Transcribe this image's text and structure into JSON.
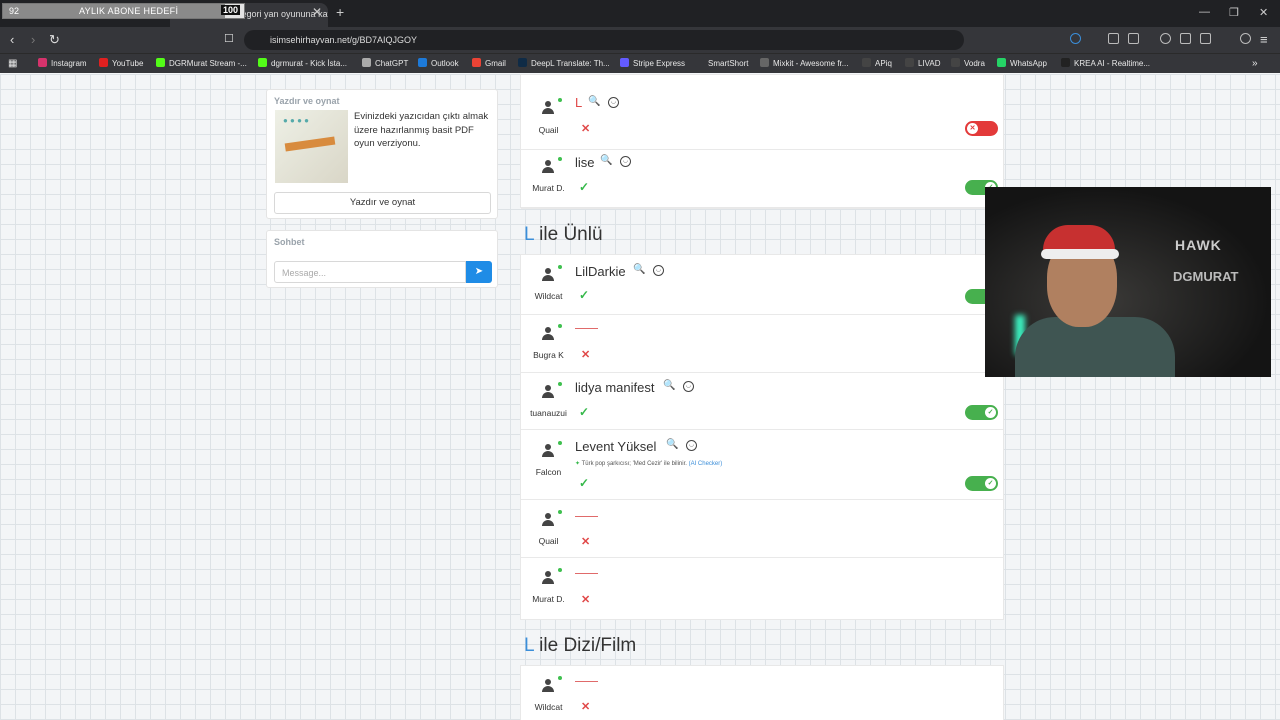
{
  "overlay": {
    "current": "92",
    "label": "AYLIK ABONE HEDEFİ",
    "goal": "100",
    "progress": 0.92
  },
  "browser": {
    "tab_title": "Kategori yan oyununa katıl",
    "url": "isimsehirhayvan.net/g/BD7AIQJGOY",
    "bookmarks": [
      {
        "label": "Instagram",
        "color": "#d6336c"
      },
      {
        "label": "YouTube",
        "color": "#e02020"
      },
      {
        "label": "DGRMurat Stream -...",
        "color": "#53fc18"
      },
      {
        "label": "dgrmurat - Kick İsta...",
        "color": "#53fc18"
      },
      {
        "label": "ChatGPT",
        "color": "#aaaaaa"
      },
      {
        "label": "Outlook",
        "color": "#1d7ad9"
      },
      {
        "label": "Gmail",
        "color": "#ea4335"
      },
      {
        "label": "DeepL Translate: Th...",
        "color": "#0f2b46"
      },
      {
        "label": "Stripe Express",
        "color": "#635bff"
      },
      {
        "label": "SmartShort",
        "color": "#35363a"
      },
      {
        "label": "Mixkit - Awesome fr...",
        "color": "#666666"
      },
      {
        "label": "APiq",
        "color": "#444444"
      },
      {
        "label": "LIVAD",
        "color": "#444444"
      },
      {
        "label": "Vodra",
        "color": "#444444"
      },
      {
        "label": "WhatsApp",
        "color": "#25d366"
      },
      {
        "label": "KREA AI - Realtime...",
        "color": "#222222"
      }
    ]
  },
  "sidebar": {
    "print": {
      "title": "Yazdır ve oynat",
      "description": "Evinizdeki yazıcıdan çıktı almak üzere hazırlanmış basit PDF oyun verziyonu.",
      "button": "Yazdır ve oynat"
    },
    "chat": {
      "title": "Sohbet",
      "placeholder": "Message..."
    }
  },
  "top_block": {
    "rows": [
      {
        "user": "Quail",
        "answer": "L",
        "valid": false
      },
      {
        "user": "Murat D.",
        "answer": "lise",
        "valid": true
      }
    ]
  },
  "sections": [
    {
      "letter": "L",
      "title": "ile Ünlü",
      "rows": [
        {
          "user": "Wildcat",
          "answer": "LilDarkie",
          "valid": true
        },
        {
          "user": "Bugra K",
          "answer": "",
          "valid": false
        },
        {
          "user": "tuanauzui",
          "answer": "lidya manifest",
          "valid": true
        },
        {
          "user": "Falcon",
          "answer": "Levent Yüksel",
          "valid": true,
          "note": "Türk pop şarkıcısı; 'Med Cezir' ile bilinir.",
          "note_source": "(AI Checker)"
        },
        {
          "user": "Quail",
          "answer": "",
          "valid": false
        },
        {
          "user": "Murat D.",
          "answer": "",
          "valid": false
        }
      ]
    },
    {
      "letter": "L",
      "title": "ile Dizi/Film",
      "rows": [
        {
          "user": "Wildcat",
          "answer": "",
          "valid": false
        }
      ]
    }
  ],
  "webcam": {
    "brand": "HAWK",
    "name": "DGMURAT"
  }
}
